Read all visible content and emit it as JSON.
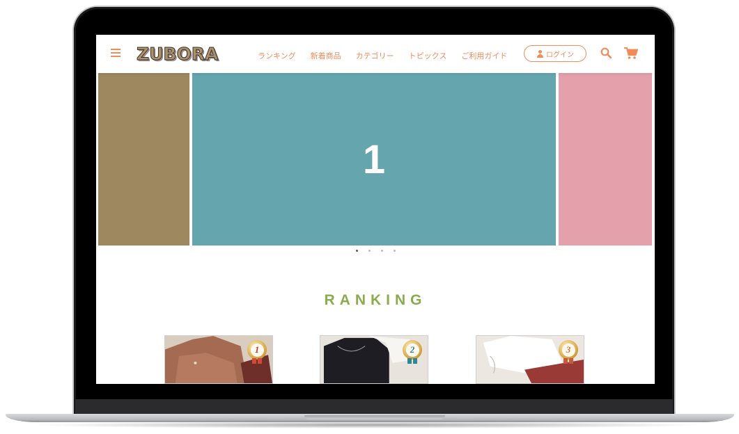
{
  "header": {
    "logo": "ZUBORA",
    "nav": [
      "ランキング",
      "新着商品",
      "カテゴリー",
      "トピックス",
      "ご利用ガイド"
    ],
    "login_label": "ログイン",
    "icons": [
      "menu-icon",
      "user-icon",
      "search-icon",
      "cart-icon"
    ]
  },
  "slider": {
    "current_label": "1",
    "total_dots": 4,
    "active_dot": 1,
    "colors": {
      "left": "#9e8860",
      "main": "#65a5ae",
      "right": "#e5a1ab"
    }
  },
  "ranking": {
    "title": "RANKING",
    "items": [
      {
        "rank": "1",
        "rank_color": "#c03a35",
        "ribbon_color": "#d04a3a"
      },
      {
        "rank": "2",
        "rank_color": "#2e7c8e",
        "ribbon_color": "#2f8796"
      },
      {
        "rank": "3",
        "rank_color": "#d4772d",
        "ribbon_color": "#c85a39"
      }
    ]
  },
  "colors": {
    "accent": "#f08b5a",
    "section_title": "#8bab4f"
  }
}
